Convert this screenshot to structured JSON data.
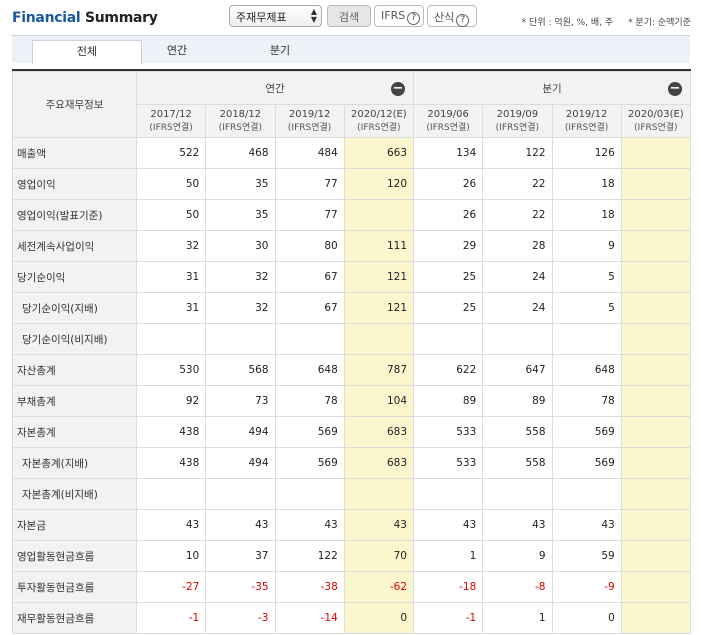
{
  "header": {
    "title_part1": "Financial",
    "title_part2": "Summary",
    "select_value": "주재무제표",
    "search_label": "검색",
    "ifrs_label": "IFRS",
    "calc_label": "산식",
    "help_glyph": "?",
    "unit_note": "* 단위 : 억원, %, 배, 주",
    "quarter_note": "* 분기: 순액기준"
  },
  "tabs": [
    "전체",
    "연간",
    "분기"
  ],
  "table": {
    "row_header": "주요재무정보",
    "group_annual": "연간",
    "group_quarter": "분기",
    "collapse_glyph": "−",
    "periods": [
      {
        "date": "2017/12",
        "basis": "(IFRS연결)"
      },
      {
        "date": "2018/12",
        "basis": "(IFRS연결)"
      },
      {
        "date": "2019/12",
        "basis": "(IFRS연결)"
      },
      {
        "date": "2020/12(E)",
        "basis": "(IFRS연결)"
      },
      {
        "date": "2019/06",
        "basis": "(IFRS연결)"
      },
      {
        "date": "2019/09",
        "basis": "(IFRS연결)"
      },
      {
        "date": "2019/12",
        "basis": "(IFRS연결)"
      },
      {
        "date": "2020/03(E)",
        "basis": "(IFRS연결)"
      }
    ],
    "rows": [
      {
        "label": "매출액",
        "sub": false,
        "values": [
          "522",
          "468",
          "484",
          "663",
          "134",
          "122",
          "126",
          ""
        ]
      },
      {
        "label": "영업이익",
        "sub": false,
        "values": [
          "50",
          "35",
          "77",
          "120",
          "26",
          "22",
          "18",
          ""
        ]
      },
      {
        "label": "영업이익(발표기준)",
        "sub": false,
        "values": [
          "50",
          "35",
          "77",
          "",
          "26",
          "22",
          "18",
          ""
        ]
      },
      {
        "label": "세전계속사업이익",
        "sub": false,
        "values": [
          "32",
          "30",
          "80",
          "111",
          "29",
          "28",
          "9",
          ""
        ]
      },
      {
        "label": "당기순이익",
        "sub": false,
        "values": [
          "31",
          "32",
          "67",
          "121",
          "25",
          "24",
          "5",
          ""
        ]
      },
      {
        "label": "당기순이익(지배)",
        "sub": true,
        "values": [
          "31",
          "32",
          "67",
          "121",
          "25",
          "24",
          "5",
          ""
        ]
      },
      {
        "label": "당기순이익(비지배)",
        "sub": true,
        "values": [
          "",
          "",
          "",
          "",
          "",
          "",
          "",
          ""
        ]
      },
      {
        "label": "자산총계",
        "sub": false,
        "values": [
          "530",
          "568",
          "648",
          "787",
          "622",
          "647",
          "648",
          ""
        ]
      },
      {
        "label": "부채총계",
        "sub": false,
        "values": [
          "92",
          "73",
          "78",
          "104",
          "89",
          "89",
          "78",
          ""
        ]
      },
      {
        "label": "자본총계",
        "sub": false,
        "values": [
          "438",
          "494",
          "569",
          "683",
          "533",
          "558",
          "569",
          ""
        ]
      },
      {
        "label": "자본총계(지배)",
        "sub": true,
        "values": [
          "438",
          "494",
          "569",
          "683",
          "533",
          "558",
          "569",
          ""
        ]
      },
      {
        "label": "자본총계(비지배)",
        "sub": true,
        "values": [
          "",
          "",
          "",
          "",
          "",
          "",
          "",
          ""
        ]
      },
      {
        "label": "자본금",
        "sub": false,
        "values": [
          "43",
          "43",
          "43",
          "43",
          "43",
          "43",
          "43",
          ""
        ]
      },
      {
        "label": "영업활동현금흐름",
        "sub": false,
        "values": [
          "10",
          "37",
          "122",
          "70",
          "1",
          "9",
          "59",
          ""
        ]
      },
      {
        "label": "투자활동현금흐름",
        "sub": false,
        "values": [
          "-27",
          "-35",
          "-38",
          "-62",
          "-18",
          "-8",
          "-9",
          ""
        ]
      },
      {
        "label": "재무활동현금흐름",
        "sub": false,
        "values": [
          "-1",
          "-3",
          "-14",
          "0",
          "-1",
          "1",
          "0",
          ""
        ]
      }
    ]
  }
}
